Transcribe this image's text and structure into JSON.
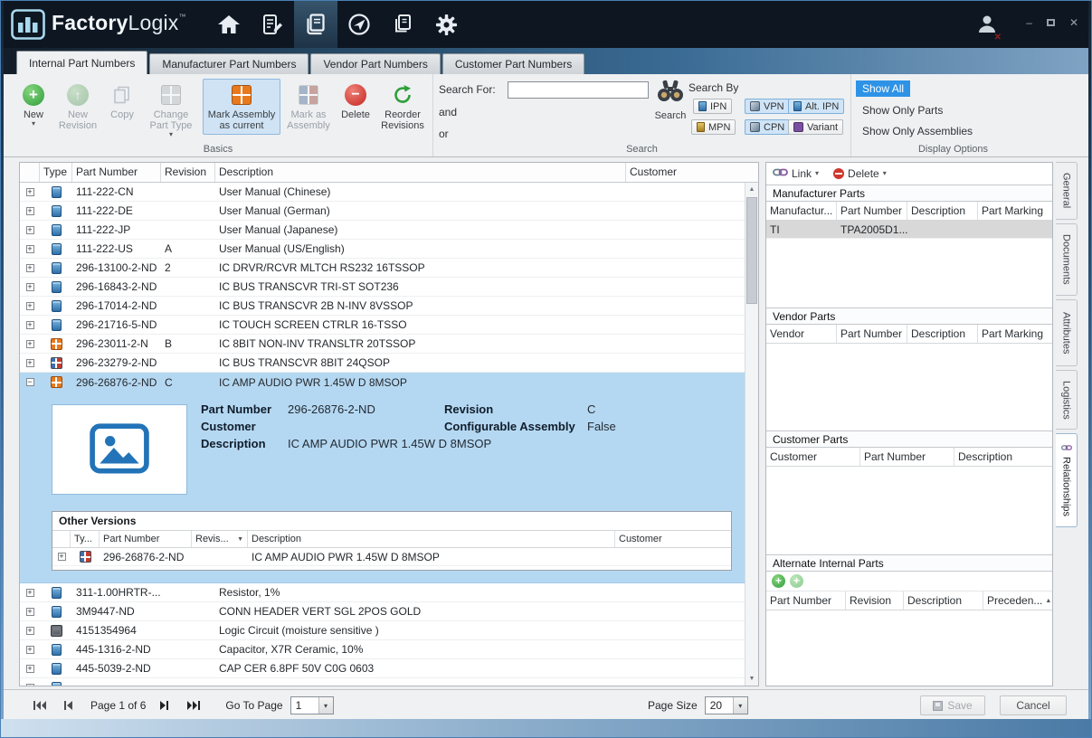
{
  "colors": {
    "titlebar_bg": "#0d1621",
    "accent_blue": "#2f7fc1",
    "selection_blue": "#b5d8f2",
    "assembly_orange": "#e8791d",
    "delete_red": "#d0362c",
    "new_green": "#2e9e3a",
    "show_all_bg": "#2e93e6"
  },
  "titlebar": {
    "brand_1": "Factory",
    "brand_2": "Logix",
    "trademark": "™"
  },
  "tabs": [
    {
      "label": "Internal Part Numbers",
      "active": true
    },
    {
      "label": "Manufacturer Part Numbers",
      "active": false
    },
    {
      "label": "Vendor Part Numbers",
      "active": false
    },
    {
      "label": "Customer Part Numbers",
      "active": false
    }
  ],
  "ribbon": {
    "basics": {
      "label": "Basics",
      "new": "New",
      "new_revision": "New Revision",
      "copy": "Copy",
      "change_part_type": "Change Part Type",
      "mark_assembly_current": "Mark Assembly as current",
      "mark_as_assembly": "Mark as Assembly",
      "delete": "Delete",
      "reorder_revisions": "Reorder Revisions"
    },
    "search": {
      "label": "Search",
      "search_for": "Search For:",
      "search_value": "",
      "and": "and",
      "or": "or",
      "search_button": "Search",
      "search_by": "Search By",
      "filters": {
        "ipn": "IPN",
        "vpn": "VPN",
        "alt_ipn": "Alt. IPN",
        "mpn": "MPN",
        "cpn": "CPN",
        "variant": "Variant"
      }
    },
    "display": {
      "label": "Display Options",
      "show_all": "Show All",
      "show_only_parts": "Show Only Parts",
      "show_only_assemblies": "Show Only Assemblies"
    }
  },
  "main_table": {
    "columns": {
      "type": "Type",
      "part_number": "Part Number",
      "revision": "Revision",
      "description": "Description",
      "customer": "Customer"
    },
    "rows": [
      {
        "icon": "document",
        "part_number": "111-222-CN",
        "revision": "",
        "description": "User Manual (Chinese)",
        "customer": ""
      },
      {
        "icon": "document",
        "part_number": "111-222-DE",
        "revision": "",
        "description": "User Manual (German)",
        "customer": ""
      },
      {
        "icon": "document",
        "part_number": "111-222-JP",
        "revision": "",
        "description": "User Manual (Japanese)",
        "customer": ""
      },
      {
        "icon": "document",
        "part_number": "111-222-US",
        "revision": "A",
        "description": "User Manual (US/English)",
        "customer": ""
      },
      {
        "icon": "document",
        "part_number": "296-13100-2-ND",
        "revision": "2",
        "description": "IC DRVR/RCVR MLTCH RS232 16TSSOP",
        "customer": ""
      },
      {
        "icon": "document",
        "part_number": "296-16843-2-ND",
        "revision": "",
        "description": "IC BUS TRANSCVR TRI-ST SOT236",
        "customer": ""
      },
      {
        "icon": "document",
        "part_number": "296-17014-2-ND",
        "revision": "",
        "description": "IC BUS TRANSCVR 2B N-INV 8VSSOP",
        "customer": ""
      },
      {
        "icon": "document",
        "part_number": "296-21716-5-ND",
        "revision": "",
        "description": "IC TOUCH SCREEN CTRLR 16-TSSO",
        "customer": ""
      },
      {
        "icon": "assembly",
        "part_number": "296-23011-2-N",
        "revision": "B",
        "description": "IC 8BIT NON-INV TRANSLTR 20TSSOP",
        "customer": ""
      },
      {
        "icon": "split",
        "part_number": "296-23279-2-ND",
        "revision": "",
        "description": "IC BUS TRANSCVR 8BIT 24QSOP",
        "customer": ""
      },
      {
        "icon": "assembly",
        "part_number": "296-26876-2-ND",
        "revision": "C",
        "description": "IC AMP AUDIO PWR 1.45W D 8MSOP",
        "customer": "",
        "selected": true
      },
      {
        "icon": "document",
        "part_number": "311-1.00HRTR-...",
        "revision": "",
        "description": "Resistor, 1%",
        "customer": ""
      },
      {
        "icon": "document",
        "part_number": "3M9447-ND",
        "revision": "",
        "description": "CONN HEADER VERT SGL 2POS GOLD",
        "customer": ""
      },
      {
        "icon": "chip",
        "part_number": "4151354964",
        "revision": "",
        "description": "Logic Circuit (moisture sensitive )",
        "customer": ""
      },
      {
        "icon": "document",
        "part_number": "445-1316-2-ND",
        "revision": "",
        "description": "Capacitor,  X7R Ceramic, 10%",
        "customer": ""
      },
      {
        "icon": "document",
        "part_number": "445-5039-2-ND",
        "revision": "",
        "description": "CAP CER 6.8PF 50V C0G 0603",
        "customer": ""
      },
      {
        "icon": "document",
        "part_number": "",
        "revision": "",
        "description": "",
        "customer": "",
        "partial": true
      }
    ]
  },
  "detail": {
    "part_number_label": "Part Number",
    "part_number": "296-26876-2-ND",
    "revision_label": "Revision",
    "revision": "C",
    "customer_label": "Customer",
    "customer": "",
    "configurable_assembly_label": "Configurable Assembly",
    "configurable_assembly": "False",
    "description_label": "Description",
    "description": "IC AMP AUDIO PWR 1.45W D 8MSOP",
    "other_versions": {
      "title": "Other Versions",
      "columns": [
        "Ty...",
        "Part Number",
        "Revis...",
        "Description",
        "Customer"
      ],
      "rows": [
        {
          "icon": "split",
          "part_number": "296-26876-2-ND",
          "revision": "",
          "description": "IC AMP AUDIO PWR 1.45W D 8MSOP",
          "customer": ""
        }
      ]
    }
  },
  "right_panel": {
    "toolbar": {
      "link_label": "Link",
      "delete_label": "Delete"
    },
    "manufacturer_parts": {
      "title": "Manufacturer Parts",
      "columns": [
        "Manufactur...",
        "Part Number",
        "Description",
        "Part Marking"
      ],
      "rows": [
        [
          "TI",
          "TPA2005D1...",
          "",
          ""
        ]
      ]
    },
    "vendor_parts": {
      "title": "Vendor Parts",
      "columns": [
        "Vendor",
        "Part Number",
        "Description",
        "Part Marking"
      ],
      "rows": []
    },
    "customer_parts": {
      "title": "Customer Parts",
      "columns": [
        "Customer",
        "Part Number",
        "Description"
      ],
      "rows": []
    },
    "alternate_parts": {
      "title": "Alternate Internal Parts",
      "columns": [
        "Part Number",
        "Revision",
        "Description",
        "Preceden..."
      ],
      "rows": []
    }
  },
  "side_tabs": [
    {
      "label": "General",
      "active": false
    },
    {
      "label": "Documents",
      "active": false
    },
    {
      "label": "Attributes",
      "active": false
    },
    {
      "label": "Logistics",
      "active": false
    },
    {
      "label": "Relationships",
      "active": true
    }
  ],
  "bottom_bar": {
    "page_text": "Page 1 of 6",
    "go_to_page_label": "Go To Page",
    "go_to_page_value": "1",
    "page_size_label": "Page Size",
    "page_size_value": "20",
    "save_label": "Save",
    "cancel_label": "Cancel"
  },
  "icons": {
    "caret_down": "▾",
    "sort_up": "▲",
    "sort_down": "▼",
    "scroll_up": "▲",
    "scroll_down": "▼",
    "minimize_glyph": "–",
    "close_glyph": "✕",
    "expand_glyph": "+",
    "collapse_glyph": "−"
  }
}
